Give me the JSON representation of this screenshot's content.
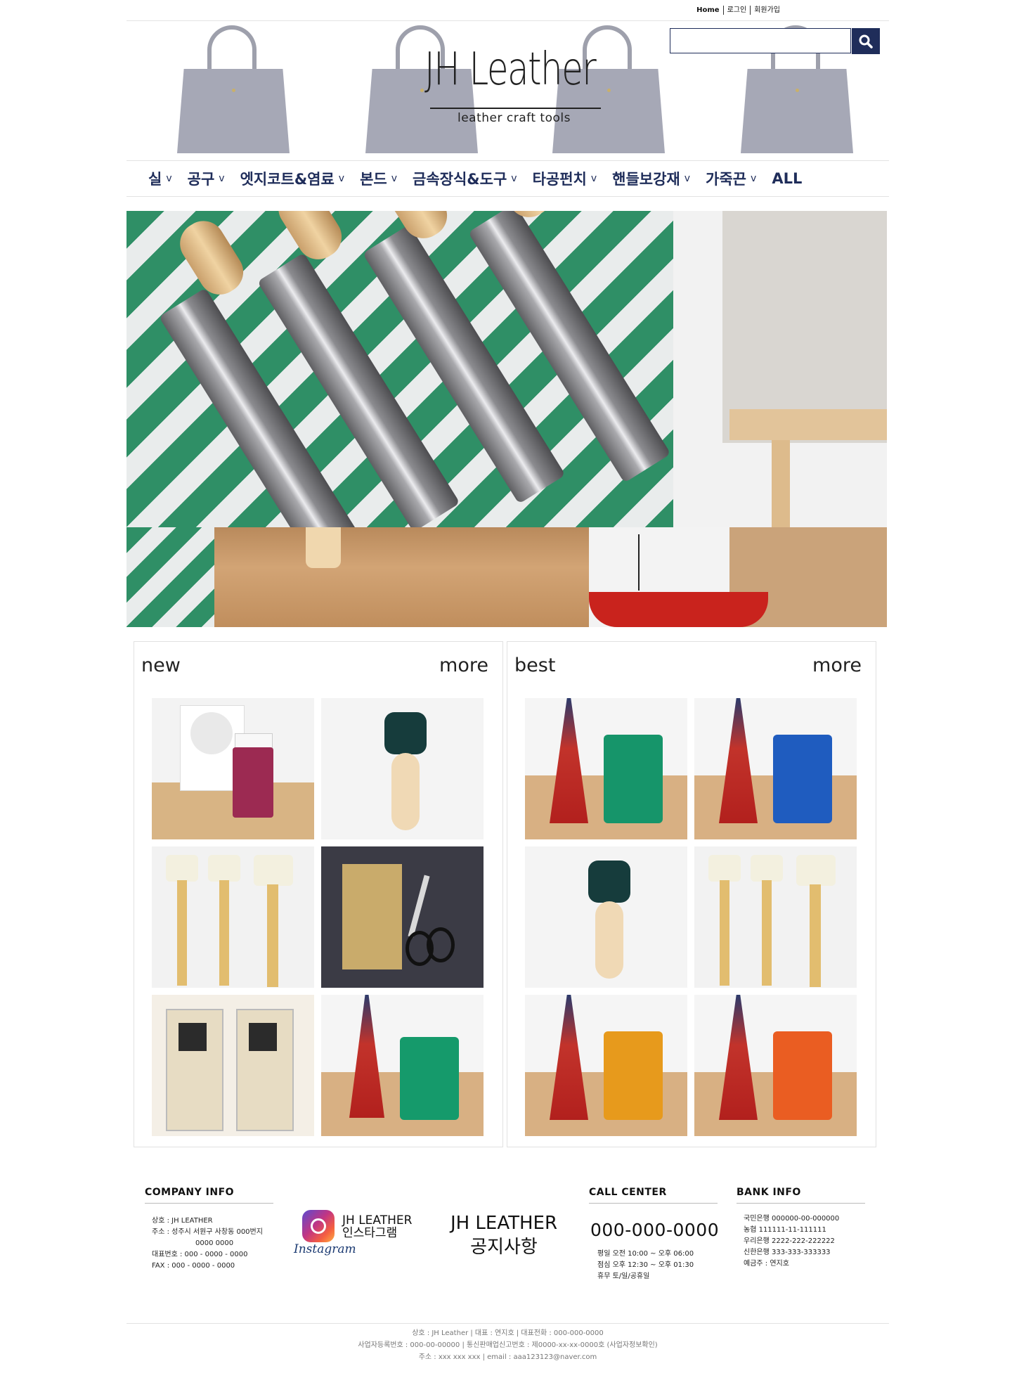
{
  "top_links": {
    "home": "Home",
    "login": "로그인",
    "signup": "회원가입"
  },
  "logo": {
    "title": "JH Leather",
    "subtitle": "leather craft tools"
  },
  "search": {
    "placeholder": ""
  },
  "nav": [
    {
      "label": "실"
    },
    {
      "label": "공구"
    },
    {
      "label": "엣지코트&염료"
    },
    {
      "label": "본드"
    },
    {
      "label": "금속장식&도구"
    },
    {
      "label": "타공펀치"
    },
    {
      "label": "핸들보강재"
    },
    {
      "label": "가죽끈"
    },
    {
      "label": "ALL"
    }
  ],
  "nav_chevron": "v",
  "panels": {
    "new": {
      "title": "new",
      "more": "more"
    },
    "best": {
      "title": "best",
      "more": "more"
    }
  },
  "footer": {
    "company": {
      "heading": "COMPANY INFO",
      "lines": [
        "상호 : JH LEATHER",
        "주소 : 성주시 서원구 사창동 000번지",
        "0000 0000",
        "대표번호 : 000 - 0000 - 0000",
        "FAX : 000 - 0000 - 0000"
      ]
    },
    "instagram": {
      "line1": "JH LEATHER",
      "line2": "인스타그램",
      "word": "Instagram"
    },
    "notice": {
      "line1": "JH LEATHER",
      "line2": "공지사항"
    },
    "call": {
      "heading": "CALL CENTER",
      "number": "000-000-0000",
      "lines": [
        "평일  오전 10:00 ~ 오후 06:00",
        "점심  오후 12:30 ~ 오후 01:30",
        "휴무  토/일/공휴일"
      ]
    },
    "bank": {
      "heading": "BANK INFO",
      "lines": [
        "국민은행 000000-00-000000",
        "농협 111111-11-111111",
        "우리은행 2222-222-222222",
        "신한은행 333-333-333333",
        "예금주 : 연지호"
      ]
    },
    "bottom": [
      "상호 : JH Leather | 대표 : 연지호 | 대표전화 : 000-000-0000",
      "사업자등록번호 : 000-00-00000 | 통신판매업신고번호 : 제0000-xx-xx-0000호 (사업자정보확인)",
      "주소 : xxx xxx xxx | email : aaa123123@naver.com"
    ]
  }
}
